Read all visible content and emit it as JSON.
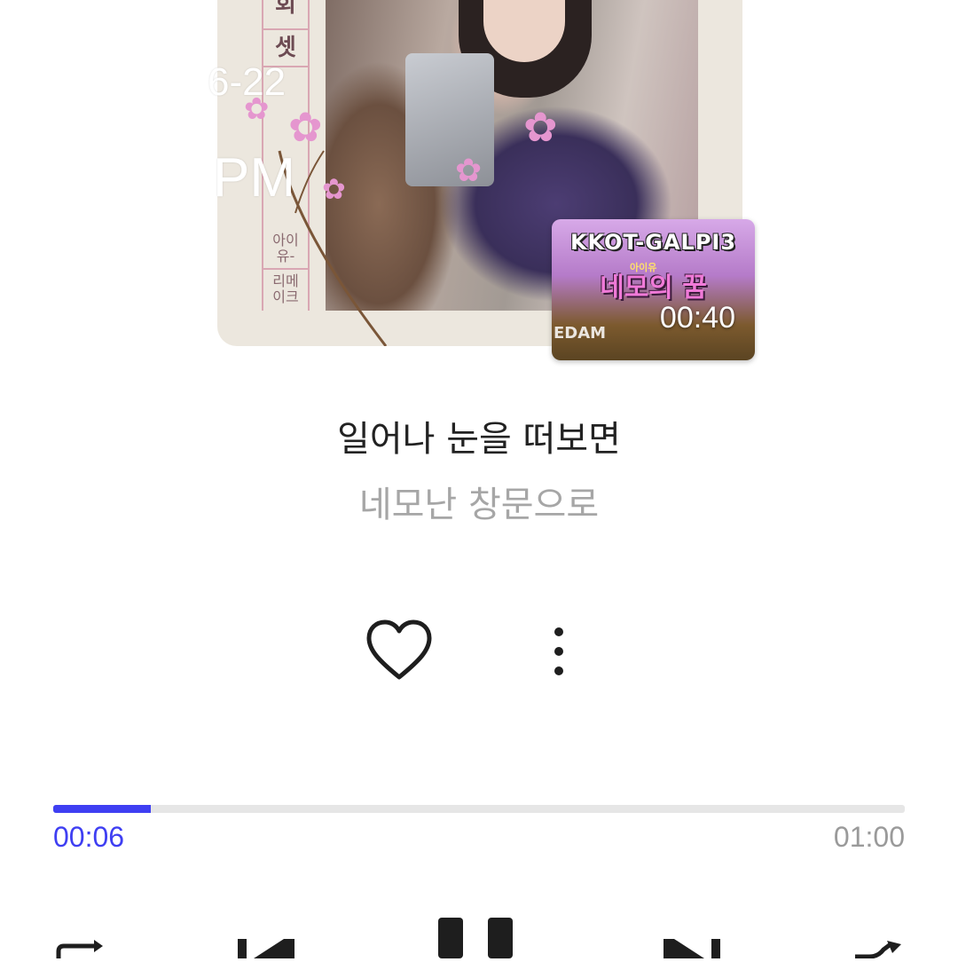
{
  "album_art": {
    "label_chars": [
      "회",
      "셋"
    ],
    "artist_text": "아이\n유-",
    "remake_text": "리메\n이크",
    "overlay_date": "6-22",
    "overlay_ampm": "PM"
  },
  "video_thumbnail": {
    "title": "KKOT-GALPI3",
    "small_text": "아이유",
    "subtitle": "네모의 꿈",
    "logo": "EDAM",
    "duration": "00:40"
  },
  "lyrics": {
    "current_line": "일어나 눈을 떠보면",
    "next_line": "네모난 창문으로"
  },
  "actions": {
    "like_icon": "heart-outline-icon",
    "more_icon": "more-vertical-icon"
  },
  "playback": {
    "current_time": "00:06",
    "total_time": "01:00",
    "progress_fraction": 0.115
  },
  "colors": {
    "accent": "#3f3ff2",
    "track": "#e6e6e6",
    "text_primary": "#222222",
    "text_secondary": "#a6a6a6"
  }
}
